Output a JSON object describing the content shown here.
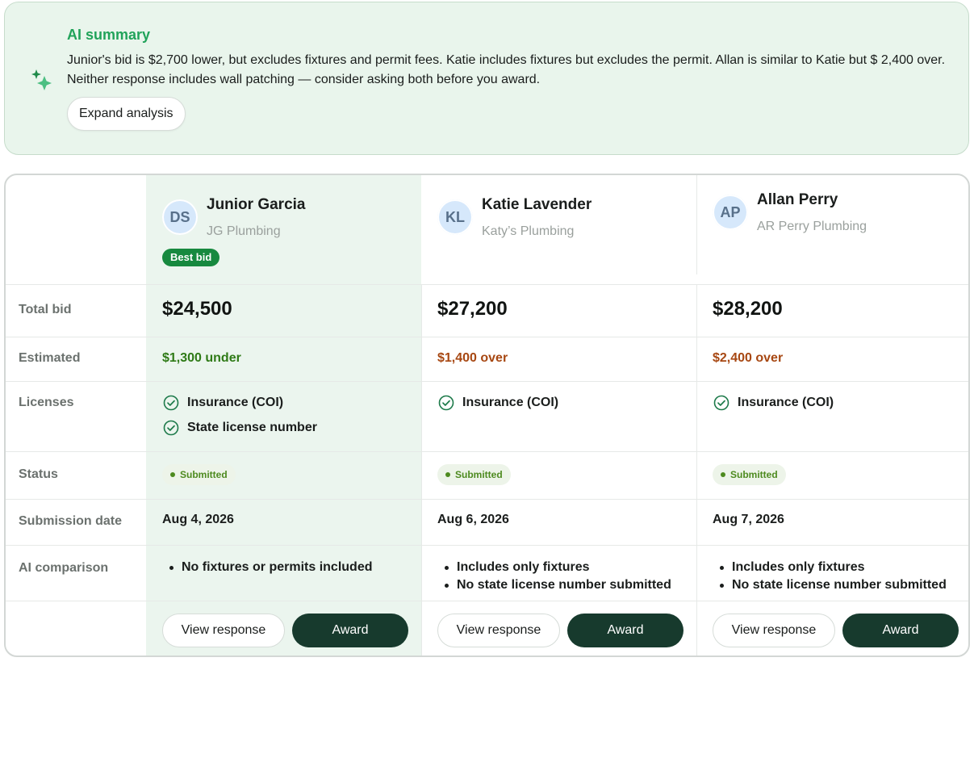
{
  "summary": {
    "title": "AI summary",
    "body": "Junior's bid is $2,700 lower, but excludes fixtures and permit fees. Katie includes fixtures but excludes the permit. Allan is similar to Katie but $ 2,400 over. Neither response includes wall patching — consider asking both before you award.",
    "expand_label": "Expand analysis",
    "icon": "sparkle-icon",
    "accent_color": "#21a35a"
  },
  "rows": {
    "total_bid": "Total bid",
    "estimated": "Estimated",
    "licenses": "Licenses",
    "status": "Status",
    "submission_date": "Submission date",
    "ai_comparison": "AI comparison"
  },
  "bidders": [
    {
      "initials": "DS",
      "name": "Junior Garcia",
      "company": "JG Plumbing",
      "badge": "Best bid",
      "total": "$24,500",
      "estimate": "$1,300 under",
      "licenses": [
        "Insurance (COI)",
        "State license number"
      ],
      "status": "Submitted",
      "date": "Aug 4, 2026",
      "comparison": [
        "No fixtures or permits included"
      ],
      "view_label": "View response",
      "award_label": "Award"
    },
    {
      "initials": "KL",
      "name": "Katie Lavender",
      "company": "Katy’s Plumbing",
      "total": "$27,200",
      "estimate": "$1,400 over",
      "licenses": [
        "Insurance (COI)"
      ],
      "status": "Submitted",
      "date": "Aug 6, 2026",
      "comparison": [
        "Includes only fixtures",
        "No state license number submitted"
      ],
      "view_label": "View response",
      "award_label": "Award"
    },
    {
      "initials": "AP",
      "name": "Allan Perry",
      "company": "AR Perry Plumbing",
      "total": "$28,200",
      "estimate": "$2,400 over",
      "licenses": [
        "Insurance (COI)"
      ],
      "status": "Submitted",
      "date": "Aug 7, 2026",
      "comparison": [
        "Includes only fixtures",
        "No state license number submitted"
      ],
      "view_label": "View response",
      "award_label": "Award"
    }
  ],
  "colors": {
    "highlight": "#ebf5ee",
    "under": "#2e7a16",
    "over": "#a74712",
    "award_button": "#173a2d",
    "best_badge": "#17893f",
    "status": "#4d8a1f"
  }
}
